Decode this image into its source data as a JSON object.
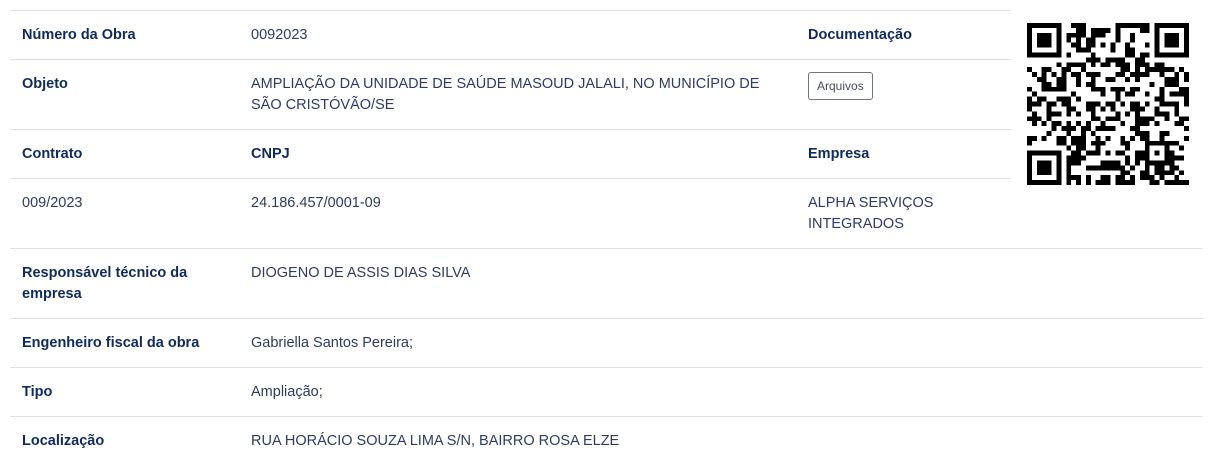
{
  "obra": {
    "numero_label": "Número da Obra",
    "numero_value": "0092023",
    "documentacao_label": "Documentação",
    "objeto_label": "Objeto",
    "objeto_value": "AMPLIAÇÃO DA UNIDADE DE SAÚDE MASOUD JALALI, NO MUNICÍPIO DE SÃO CRISTÓVÃO/SE",
    "arquivos_button": "Arquivos",
    "contrato_label": "Contrato",
    "contrato_value": "009/2023",
    "cnpj_label": "CNPJ",
    "cnpj_value": "24.186.457/0001-09",
    "empresa_label": "Empresa",
    "empresa_value": "ALPHA SERVIÇOS INTEGRADOS",
    "responsavel_label": "Responsável técnico da empresa",
    "responsavel_value": "DIOGENO DE ASSIS DIAS SILVA",
    "engenheiro_label": "Engenheiro fiscal da obra",
    "engenheiro_value": "Gabriella Santos Pereira;",
    "tipo_label": "Tipo",
    "tipo_value": "Ampliação;",
    "localizacao_label": "Localização",
    "localizacao_value": "RUA HORÁCIO SOUZA LIMA S/N, BAIRRO ROSA ELZE"
  },
  "colors": {
    "label": "#0f2a5c",
    "value": "#2e3b63",
    "border": "#dee2e6"
  },
  "qr_code": {
    "icon": "qr-code-icon"
  }
}
